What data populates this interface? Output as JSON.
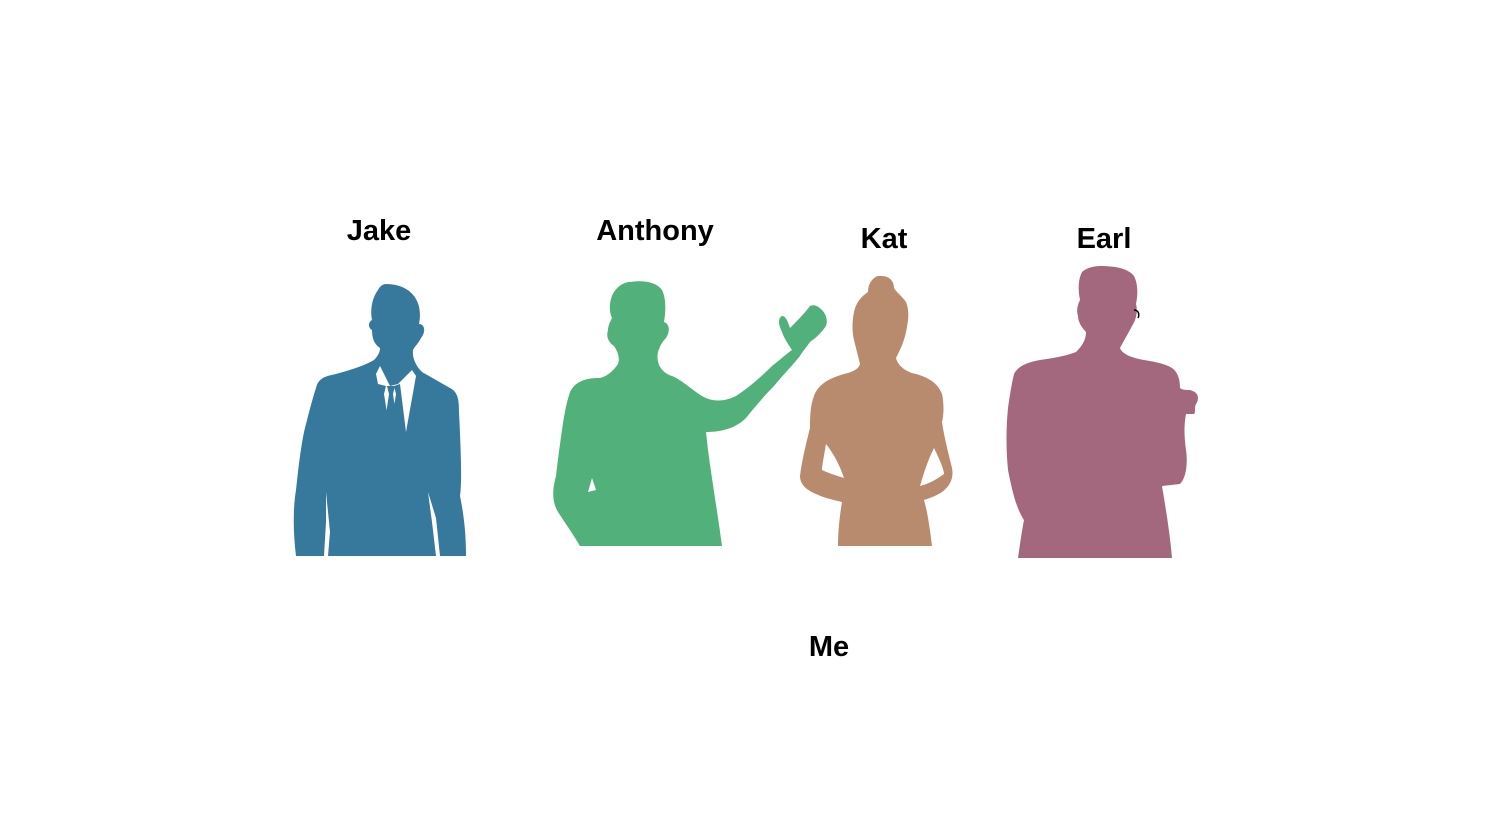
{
  "people": [
    {
      "name": "Jake",
      "color": "#37799d",
      "icon": "man-in-suit-silhouette-icon"
    },
    {
      "name": "Anthony",
      "color": "#52b17a",
      "icon": "man-waving-silhouette-icon"
    },
    {
      "name": "Kat",
      "color": "#b88a6e",
      "icon": "woman-silhouette-icon"
    },
    {
      "name": "Earl",
      "color": "#a3687e",
      "icon": "man-with-glasses-silhouette-icon"
    }
  ],
  "self_label": "Me"
}
